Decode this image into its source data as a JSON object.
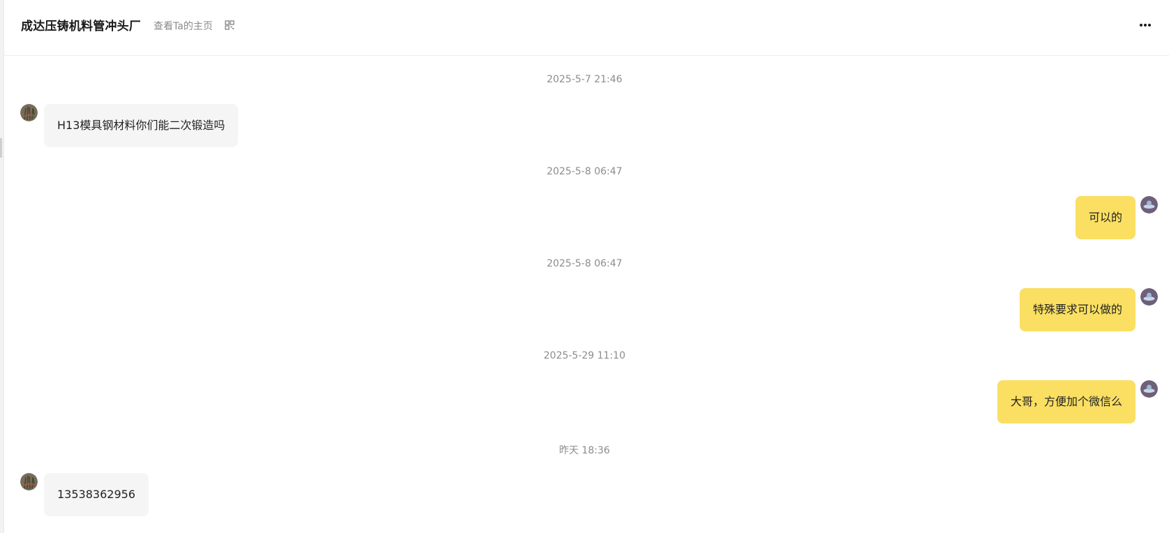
{
  "header": {
    "title": "成达压铸机料管冲头厂",
    "profile_link": "查看Ta的主页",
    "qr_icon": "qr-code-icon",
    "more_icon": "more-horizontal-icon"
  },
  "colors": {
    "outgoing_bubble": "#fadf63",
    "incoming_bubble": "#f5f5f5",
    "timestamp": "#8c8c8c"
  },
  "messages": [
    {
      "time": "2025-5-7 21:46",
      "direction": "incoming",
      "text": "H13模具钢材料你们能二次锻造吗"
    },
    {
      "time": "2025-5-8 06:47",
      "direction": "outgoing",
      "text": "可以的"
    },
    {
      "time": "2025-5-8 06:47",
      "direction": "outgoing",
      "text": "特殊要求可以做的"
    },
    {
      "time": "2025-5-29 11:10",
      "direction": "outgoing",
      "text": "大哥，方便加个微信么"
    },
    {
      "time": "昨天 18:36",
      "direction": "incoming",
      "text": "13538362956"
    }
  ]
}
